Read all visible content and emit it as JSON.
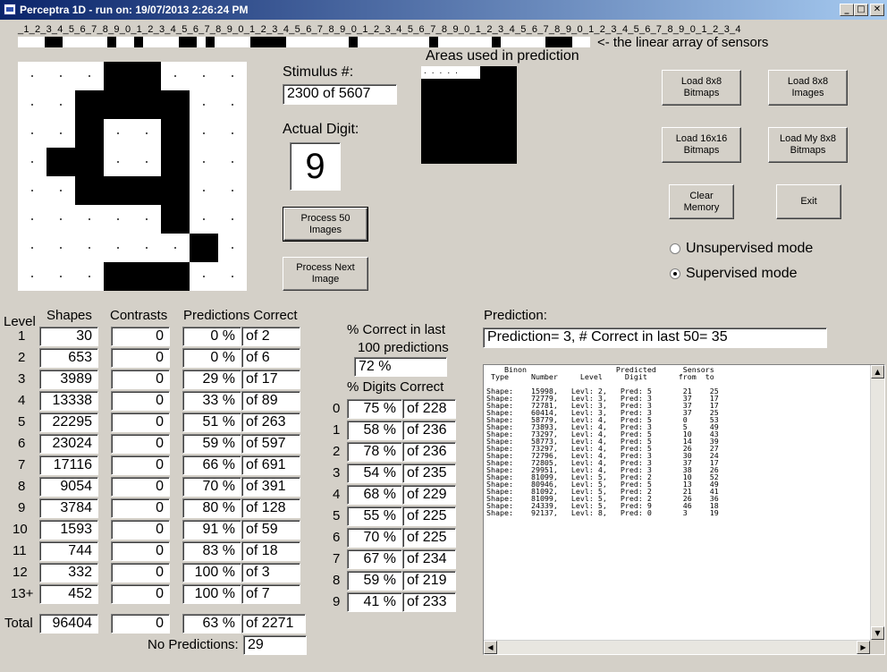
{
  "window": {
    "title": "Perceptra 1D - run on: 19/07/2013  2:26:24 PM",
    "min_glyph": "_",
    "max_glyph": "□",
    "close_glyph": "✕"
  },
  "sensors": {
    "digits_label": "_1_2_3_4_5_6_7_8_9_0_1_2_3_4_5_6_7_8_9_0_1_2_3_4_5_6_7_8_9_0_1_2_3_4_5_6_7_8_9_0_1_2_3_4_5_6_7_8_9_0_1_2_3_4_5_6_7_8_9_0_1_2_3_4",
    "caption": "<- the linear array of sensors",
    "count": 64,
    "on_indices": [
      3,
      4,
      10,
      13,
      18,
      19,
      21,
      26,
      27,
      28,
      29,
      37,
      46,
      53,
      59,
      60,
      61
    ]
  },
  "bitmap": {
    "rows": [
      [
        0,
        0,
        0,
        1,
        1,
        0,
        0,
        0
      ],
      [
        0,
        0,
        1,
        1,
        1,
        1,
        0,
        0
      ],
      [
        0,
        0,
        1,
        0,
        0,
        1,
        0,
        0
      ],
      [
        0,
        1,
        1,
        0,
        0,
        1,
        0,
        0
      ],
      [
        0,
        0,
        1,
        1,
        1,
        1,
        0,
        0
      ],
      [
        0,
        0,
        0,
        0,
        0,
        1,
        0,
        0
      ],
      [
        0,
        0,
        0,
        0,
        0,
        0,
        1,
        0
      ],
      [
        0,
        0,
        0,
        0,
        0,
        1,
        0,
        0
      ]
    ],
    "last_row": [
      0,
      0,
      0,
      1,
      1,
      1,
      0,
      0
    ]
  },
  "stimulus": {
    "label": "Stimulus #:",
    "value": "2300  of 5607"
  },
  "actual_digit": {
    "label": "Actual Digit:",
    "value": "9"
  },
  "areas": {
    "label": "Areas used in prediction",
    "dots": "....."
  },
  "buttons": {
    "process50": "Process 50 Images",
    "process_next": "Process Next Image",
    "load8x8bitmaps": "Load 8x8 Bitmaps",
    "load8x8images": "Load 8x8 Images",
    "load16x16": "Load 16x16 Bitmaps",
    "load_my8x8": "Load My 8x8 Bitmaps",
    "clear_memory": "Clear Memory",
    "exit": "Exit"
  },
  "modes": {
    "unsupervised": "Unsupervised mode",
    "supervised": "Supervised mode",
    "selected": "supervised"
  },
  "table": {
    "headers": {
      "level": "Level",
      "shapes": "Shapes",
      "contrasts": "Contrasts",
      "predictions": "Predictions Correct"
    },
    "rows": [
      {
        "level": "1",
        "shapes": "30",
        "contrasts": "0",
        "pct": "0 %",
        "of": "of 2"
      },
      {
        "level": "2",
        "shapes": "653",
        "contrasts": "0",
        "pct": "0 %",
        "of": "of 6"
      },
      {
        "level": "3",
        "shapes": "3989",
        "contrasts": "0",
        "pct": "29 %",
        "of": "of 17"
      },
      {
        "level": "4",
        "shapes": "13338",
        "contrasts": "0",
        "pct": "33 %",
        "of": "of 89"
      },
      {
        "level": "5",
        "shapes": "22295",
        "contrasts": "0",
        "pct": "51 %",
        "of": "of 263"
      },
      {
        "level": "6",
        "shapes": "23024",
        "contrasts": "0",
        "pct": "59 %",
        "of": "of 597"
      },
      {
        "level": "7",
        "shapes": "17116",
        "contrasts": "0",
        "pct": "66 %",
        "of": "of 691"
      },
      {
        "level": "8",
        "shapes": "9054",
        "contrasts": "0",
        "pct": "70 %",
        "of": "of 391"
      },
      {
        "level": "9",
        "shapes": "3784",
        "contrasts": "0",
        "pct": "80 %",
        "of": "of 128"
      },
      {
        "level": "10",
        "shapes": "1593",
        "contrasts": "0",
        "pct": "91 %",
        "of": "of 59"
      },
      {
        "level": "11",
        "shapes": "744",
        "contrasts": "0",
        "pct": "83 %",
        "of": "of 18"
      },
      {
        "level": "12",
        "shapes": "332",
        "contrasts": "0",
        "pct": "100 %",
        "of": "of 3"
      },
      {
        "level": "13+",
        "shapes": "452",
        "contrasts": "0",
        "pct": "100 %",
        "of": "of 7"
      }
    ],
    "total": {
      "label": "Total",
      "shapes": "96404",
      "contrasts": "0",
      "pct": "63 %",
      "of": "of 2271"
    },
    "no_predictions_label": "No Predictions:",
    "no_predictions_value": "29"
  },
  "last100": {
    "label_line1": "% Correct in last",
    "label_line2": "100 predictions",
    "value": "72 %"
  },
  "digits_correct": {
    "label": "% Digits Correct",
    "rows": [
      {
        "digit": "0",
        "pct": "75 %",
        "of": "of 228"
      },
      {
        "digit": "1",
        "pct": "58 %",
        "of": "of 236"
      },
      {
        "digit": "2",
        "pct": "78 %",
        "of": "of 236"
      },
      {
        "digit": "3",
        "pct": "54 %",
        "of": "of 235"
      },
      {
        "digit": "4",
        "pct": "68 %",
        "of": "of 229"
      },
      {
        "digit": "5",
        "pct": "55 %",
        "of": "of 225"
      },
      {
        "digit": "6",
        "pct": "70 %",
        "of": "of 225"
      },
      {
        "digit": "7",
        "pct": "67 %",
        "of": "of 234"
      },
      {
        "digit": "8",
        "pct": "59 %",
        "of": "of 219"
      },
      {
        "digit": "9",
        "pct": "41 %",
        "of": "of 233"
      }
    ]
  },
  "prediction": {
    "label": "Prediction:",
    "value": "Prediction= 3, # Correct in last 50= 35"
  },
  "log": {
    "text": "    Binon                    Predicted      Sensors\n Type     Number     Level     Digit       from  to\n\nShape:    15998,   Levl: 2,   Pred: 5       21    25\nShape:    72779,   Levl: 3,   Pred: 3       37    17\nShape:    72781,   Levl: 3,   Pred: 3       37    17\nShape:    60414,   Levl: 3,   Pred: 3       37    25\nShape:    58779,   Levl: 4,   Pred: 5       0     53\nShape:    73893,   Levl: 4,   Pred: 3       5     49\nShape:    73297,   Levl: 4,   Pred: 5       10    43\nShape:    58773,   Levl: 4,   Pred: 5       14    39\nShape:    73297,   Levl: 4,   Pred: 5       26    27\nShape:    72796,   Levl: 4,   Pred: 3       30    24\nShape:    72805,   Levl: 4,   Pred: 3       37    17\nShape:    29951,   Levl: 4,   Pred: 3       38    26\nShape:    81099,   Levl: 5,   Pred: 2       10    52\nShape:    80946,   Levl: 5,   Pred: 5       13    49\nShape:    81092,   Levl: 5,   Pred: 2       21    41\nShape:    81099,   Levl: 5,   Pred: 2       26    36\nShape:    24339,   Levl: 5,   Pred: 9       46    18\nShape:    92137,   Levl: 8,   Pred: 0       3     19",
    "up": "▲",
    "down": "▼",
    "left": "◀",
    "right": "▶"
  }
}
